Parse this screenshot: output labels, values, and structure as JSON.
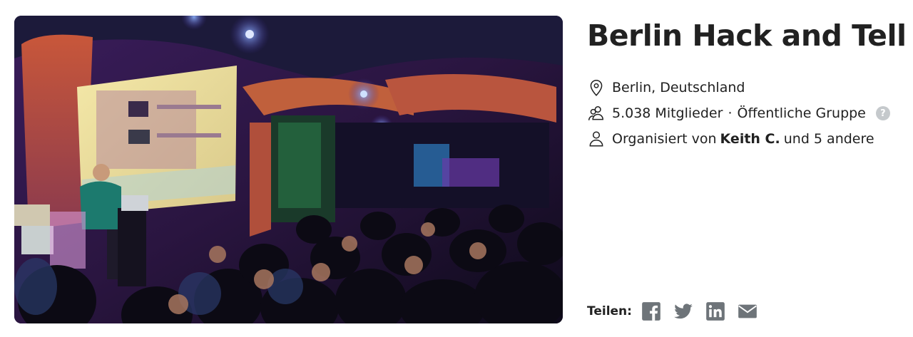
{
  "group": {
    "title": "Berlin Hack and Tell",
    "location": "Berlin, Deutschland",
    "members": "5.038 Mitglieder",
    "separator": "·",
    "visibility": "Öffentliche Gruppe",
    "help_symbol": "?",
    "organizer_prefix": "Organisiert von",
    "organizer_name": "Keith C.",
    "organizer_suffix": "und 5 andere"
  },
  "share": {
    "label": "Teilen:",
    "icons": [
      "facebook-icon",
      "twitter-icon",
      "linkedin-icon",
      "email-icon"
    ]
  },
  "colors": {
    "text": "#212121",
    "icon_gray": "#6e7479",
    "help_badge": "#c5c9cc"
  }
}
